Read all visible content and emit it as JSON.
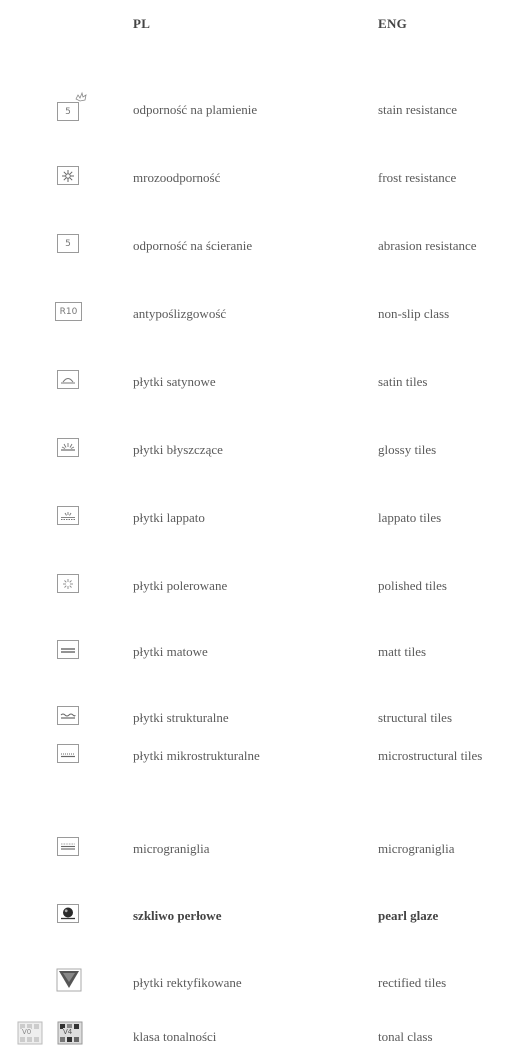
{
  "header": {
    "pl": "PL",
    "eng": "ENG"
  },
  "rows": [
    {
      "icon": "stain-resistance-icon",
      "icon_text": "5",
      "pl": "odporność na plamienie",
      "eng": "stain resistance"
    },
    {
      "icon": "snowflake-icon",
      "pl": "mrozoodporność",
      "eng": "frost resistance"
    },
    {
      "icon": "abrasion-icon",
      "icon_text": "5",
      "pl": "odporność na ścieranie",
      "eng": "abrasion resistance"
    },
    {
      "icon": "non-slip-icon",
      "icon_text": "R10",
      "pl": "antypoślizgowość",
      "eng": "non-slip class"
    },
    {
      "icon": "satin-icon",
      "pl": "płytki satynowe",
      "eng": "satin tiles"
    },
    {
      "icon": "glossy-icon",
      "pl": "płytki błyszczące",
      "eng": "glossy tiles"
    },
    {
      "icon": "lappato-icon",
      "pl": "płytki lappato",
      "eng": "lappato tiles"
    },
    {
      "icon": "polished-icon",
      "pl": "płytki polerowane",
      "eng": "polished tiles"
    },
    {
      "icon": "matt-icon",
      "pl": "płytki matowe",
      "eng": "matt tiles"
    },
    {
      "icon": "structural-icon",
      "pl": "płytki strukturalne",
      "eng": "structural tiles"
    },
    {
      "icon": "microstructural-icon",
      "pl": "płytki mikrostrukturalne",
      "eng": "microstructural tiles"
    },
    {
      "icon": "micrograniglia-icon",
      "pl": "micrograniglia",
      "eng": "micrograniglia"
    },
    {
      "icon": "pearl-glaze-icon",
      "pl": "szkliwo perłowe",
      "eng": "pearl glaze"
    },
    {
      "icon": "rectified-icon",
      "pl": "płytki rektyfikowane",
      "eng": "rectified tiles"
    },
    {
      "icon": "tonal-class-icon",
      "icon_text": "V0",
      "icon_text2": "V4",
      "pl": "klasa tonalności",
      "eng": "tonal class"
    }
  ]
}
